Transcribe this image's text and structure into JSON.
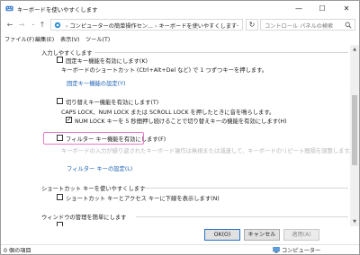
{
  "window": {
    "title": "キーボードを使いやすくします",
    "minimize": "—",
    "maximize": "☐",
    "close": "✕"
  },
  "address": {
    "back": "←",
    "forward": "→",
    "dropdown": "⌄",
    "up": "↑",
    "breadcrumb": [
      "コンピューターの簡単操作セン...",
      "キーボードを使いやすくします"
    ],
    "separator": "›",
    "refresh": "↻",
    "search_placeholder": "コントロール パネルの検索"
  },
  "menu": [
    "ファイル(F)",
    "編集(E)",
    "表示(V)",
    "ツール(T)"
  ],
  "content": {
    "section_typing": "入力しやすくします",
    "sticky_keys_label": "固定キー機能を有効にします(K)",
    "sticky_keys_desc": "キーボードのショートカット (Ctrl+Alt+Del など) で 1 つずつキーを押します。",
    "sticky_keys_link": "固定キー機能の設定(Y)",
    "toggle_keys_label": "切り替えキー機能を有効にします(T)",
    "toggle_keys_desc": "CAPS LOCK、NUM LOCK または SCROLL LOCK を押したときに音を鳴らします。",
    "toggle_keys_sub_label": "NUM LOCK キーを 5 秒間押し続けることで切り替えキーの機能を有効にします(H)",
    "filter_keys_label": "フィルター キー機能を有効にします(F)",
    "filter_keys_desc": "キーボードの入力が繰り返されたキーボード操作は無視または減速して、キーボードのリピート間隔を調整します。",
    "filter_keys_link": "フィルター キーの設定(L)",
    "section_shortcuts": "ショートカット キーを使いやすくします",
    "underline_label": "ショートカット キーとアクセス キーに下線を表示します(N)",
    "section_window": "ウィンドウの管理を簡単にします"
  },
  "checkboxes": {
    "sticky_keys": false,
    "toggle_keys": false,
    "toggle_keys_sub": true,
    "filter_keys": false,
    "underline": false
  },
  "buttons": {
    "ok": "OK(O)",
    "cancel": "キャンセル",
    "apply": "適用(A)"
  },
  "status": {
    "items": "0 個の項目",
    "location": "コンピューター"
  },
  "colors": {
    "link": "#1a5fb4",
    "highlight": "#e878c8"
  }
}
